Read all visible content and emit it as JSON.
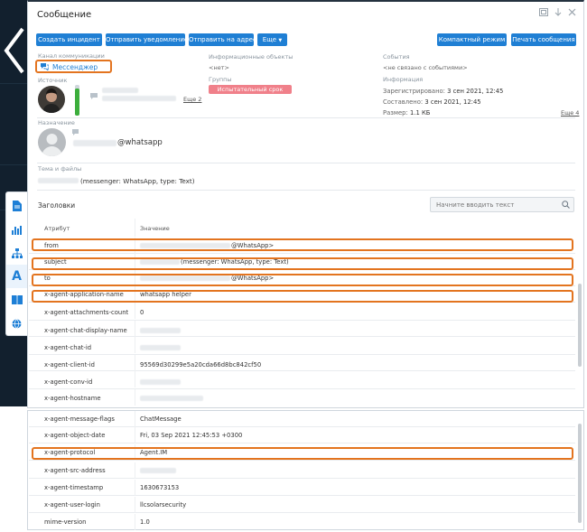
{
  "window": {
    "title": "Сообщение"
  },
  "toolbar": {
    "create_incident": "Создать инцидент",
    "send_notification": "Отправить уведомление",
    "send_to_address": "Отправить на адрес",
    "more": "Еще",
    "compact_mode": "Компактный режим",
    "print_message": "Печать сообщения"
  },
  "info": {
    "channel_label": "Канал коммуникации",
    "channel_value": "Мессенджер",
    "info_objects_label": "Информационные объекты",
    "info_objects_value": "<нет>",
    "events_label": "События",
    "events_value": "<не связано с событиями>",
    "source_label": "Источник",
    "more_source": "Еще 2",
    "groups_label": "Группы",
    "groups_badge": "Испытательный срок",
    "information_label": "Информация",
    "registered_label": "Зарегистрировано:",
    "registered_value": "3 сен 2021, 12:45",
    "composed_label": "Составлено:",
    "composed_value": "3 сен 2021, 12:45",
    "size_label": "Размер:",
    "size_value": "1.1 КБ",
    "more_info": "Еще 4",
    "destination_label": "Назначение",
    "destination_suffix": "@whatsapp",
    "subject_label": "Тема и файлы",
    "subject_suffix": "(messenger: WhatsApp, type: Text)"
  },
  "headers": {
    "section_title": "Заголовки",
    "search_placeholder": "Начните вводить текст",
    "col_attribute": "Атрибут",
    "col_value": "Значение",
    "rows": [
      {
        "attr": "from",
        "value": "@WhatsApp>"
      },
      {
        "attr": "subject",
        "value": "(messenger: WhatsApp, type: Text)"
      },
      {
        "attr": "to",
        "value": "@WhatsApp>"
      },
      {
        "attr": "x-agent-application-name",
        "value": "whatsapp helper"
      },
      {
        "attr": "x-agent-attachments-count",
        "value": "0"
      },
      {
        "attr": "x-agent-chat-display-name",
        "value": ""
      },
      {
        "attr": "x-agent-chat-id",
        "value": ""
      },
      {
        "attr": "x-agent-client-id",
        "value": "95569d30299e5a20cda66d8bc842cf50"
      },
      {
        "attr": "x-agent-conv-id",
        "value": ""
      },
      {
        "attr": "x-agent-hostname",
        "value": ""
      }
    ],
    "rows2": [
      {
        "attr": "x-agent-message-flags",
        "value": "ChatMessage"
      },
      {
        "attr": "x-agent-object-date",
        "value": "Fri, 03 Sep 2021 12:45:53 +0300"
      },
      {
        "attr": "x-agent-protocol",
        "value": "Agent.IM"
      },
      {
        "attr": "x-agent-src-address",
        "value": ""
      },
      {
        "attr": "x-agent-timestamp",
        "value": "1630673153"
      },
      {
        "attr": "x-agent-user-login",
        "value": "llcsolarsecurity"
      },
      {
        "attr": "mime-version",
        "value": "1.0"
      }
    ]
  },
  "colors": {
    "accent": "#1f7fd4",
    "highlight": "#e3741f",
    "group_badge": "#f0808a"
  },
  "icons": [
    "back-chevron-icon",
    "document-icon",
    "chart-icon",
    "hierarchy-icon",
    "letter-a-icon",
    "book-icon",
    "globe-icon",
    "messenger-icon",
    "chat-icon",
    "search-icon",
    "restore-window-icon",
    "arrow-down-icon",
    "close-icon"
  ]
}
